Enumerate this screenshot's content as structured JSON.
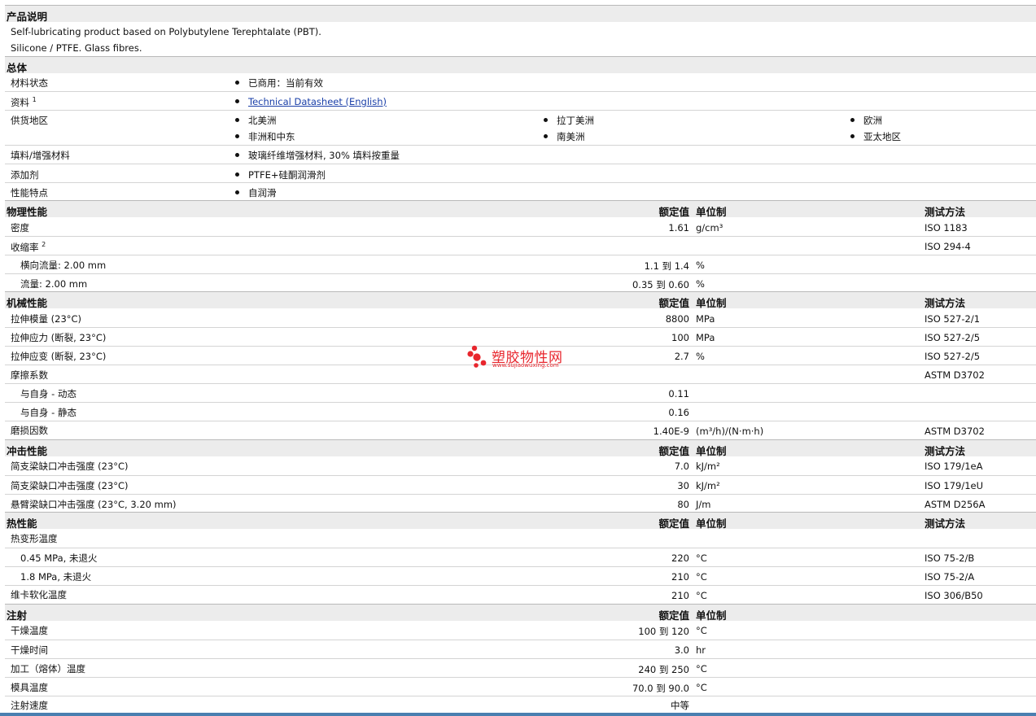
{
  "sections": {
    "description": {
      "title": "产品说明",
      "line1": "Self-lubricating product based on Polybutylene Terephtalate (PBT).",
      "line2": "Silicone / PTFE. Glass fibres."
    },
    "general": {
      "title": "总体",
      "status_label": "材料状态",
      "status_value": "已商用：当前有效",
      "docs_label": "资料",
      "docs_sup": "1",
      "docs_link": "Technical Datasheet (English)",
      "supply_label": "供货地区",
      "supply": [
        "北美洲",
        "拉丁美洲",
        "欧洲",
        "非洲和中东",
        "南美洲",
        "亚太地区"
      ],
      "filler_label": "填料/增强材料",
      "filler_value": "玻璃纤维增强材料, 30% 填料按重量",
      "additive_label": "添加剂",
      "additive_value": "PTFE+硅酮润滑剂",
      "feature_label": "性能特点",
      "feature_value": "自润滑"
    },
    "headers": {
      "value": "额定值",
      "unit": "单位制",
      "method": "测试方法"
    },
    "physical": {
      "title": "物理性能",
      "rows": [
        {
          "label": "密度",
          "value": "1.61",
          "unit": "g/cm³",
          "method": "ISO 1183"
        },
        {
          "label": "收缩率",
          "sup": "2",
          "value": "",
          "unit": "",
          "method": "ISO 294-4"
        },
        {
          "label": "横向流量: 2.00 mm",
          "value": "1.1 到  1.4",
          "unit": "%",
          "method": ""
        },
        {
          "label": "流量: 2.00 mm",
          "value": "0.35 到  0.60",
          "unit": "%",
          "method": ""
        }
      ]
    },
    "mechanical": {
      "title": "机械性能",
      "rows": [
        {
          "label": "拉伸模量  (23°C)",
          "value": "8800",
          "unit": "MPa",
          "method": "ISO 527-2/1"
        },
        {
          "label": "拉伸应力  (断裂, 23°C)",
          "value": "100",
          "unit": "MPa",
          "method": "ISO 527-2/5"
        },
        {
          "label": "拉伸应变  (断裂, 23°C)",
          "value": "2.7",
          "unit": "%",
          "method": "ISO 527-2/5"
        },
        {
          "label": "摩擦系数",
          "value": "",
          "unit": "",
          "method": "ASTM D3702"
        },
        {
          "label": "与自身  - 动态",
          "value": "0.11",
          "unit": "",
          "method": ""
        },
        {
          "label": "与自身  - 静态",
          "value": "0.16",
          "unit": "",
          "method": ""
        },
        {
          "label": "磨损因数",
          "value": "1.40E-9",
          "unit": "(m³/h)/(N·m·h)",
          "method": "ASTM D3702"
        }
      ]
    },
    "impact": {
      "title": "冲击性能",
      "rows": [
        {
          "label": "简支梁缺口冲击强度  (23°C)",
          "value": "7.0",
          "unit": "kJ/m²",
          "method": "ISO 179/1eA"
        },
        {
          "label": "简支梁缺口冲击强度  (23°C)",
          "value": "30",
          "unit": "kJ/m²",
          "method": "ISO 179/1eU"
        },
        {
          "label": "悬臂梁缺口冲击强度  (23°C, 3.20 mm)",
          "value": "80",
          "unit": "J/m",
          "method": "ASTM D256A"
        }
      ]
    },
    "thermal": {
      "title": "热性能",
      "rows": [
        {
          "label": "热变形温度",
          "value": "",
          "unit": "",
          "method": ""
        },
        {
          "label": "0.45 MPa, 未退火",
          "value": "220",
          "unit": "°C",
          "method": "ISO 75-2/B"
        },
        {
          "label": "1.8 MPa, 未退火",
          "value": "210",
          "unit": "°C",
          "method": "ISO 75-2/A"
        },
        {
          "label": "维卡软化温度",
          "value": "210",
          "unit": "°C",
          "method": "ISO 306/B50"
        }
      ]
    },
    "injection": {
      "title": "注射",
      "rows": [
        {
          "label": "干燥温度",
          "value": "100 到  120",
          "unit": "°C"
        },
        {
          "label": "干燥时间",
          "value": "3.0",
          "unit": "hr"
        },
        {
          "label": "加工（熔体）温度",
          "value": "240 到  250",
          "unit": "°C"
        },
        {
          "label": "模具温度",
          "value": "70.0 到  90.0",
          "unit": "°C"
        },
        {
          "label": "注射速度",
          "value": "中等",
          "unit": ""
        }
      ]
    }
  },
  "watermark": {
    "text": "塑胶物性网",
    "url": "www.sujiaowuxing.com",
    "dot_color": "#e8262d"
  }
}
